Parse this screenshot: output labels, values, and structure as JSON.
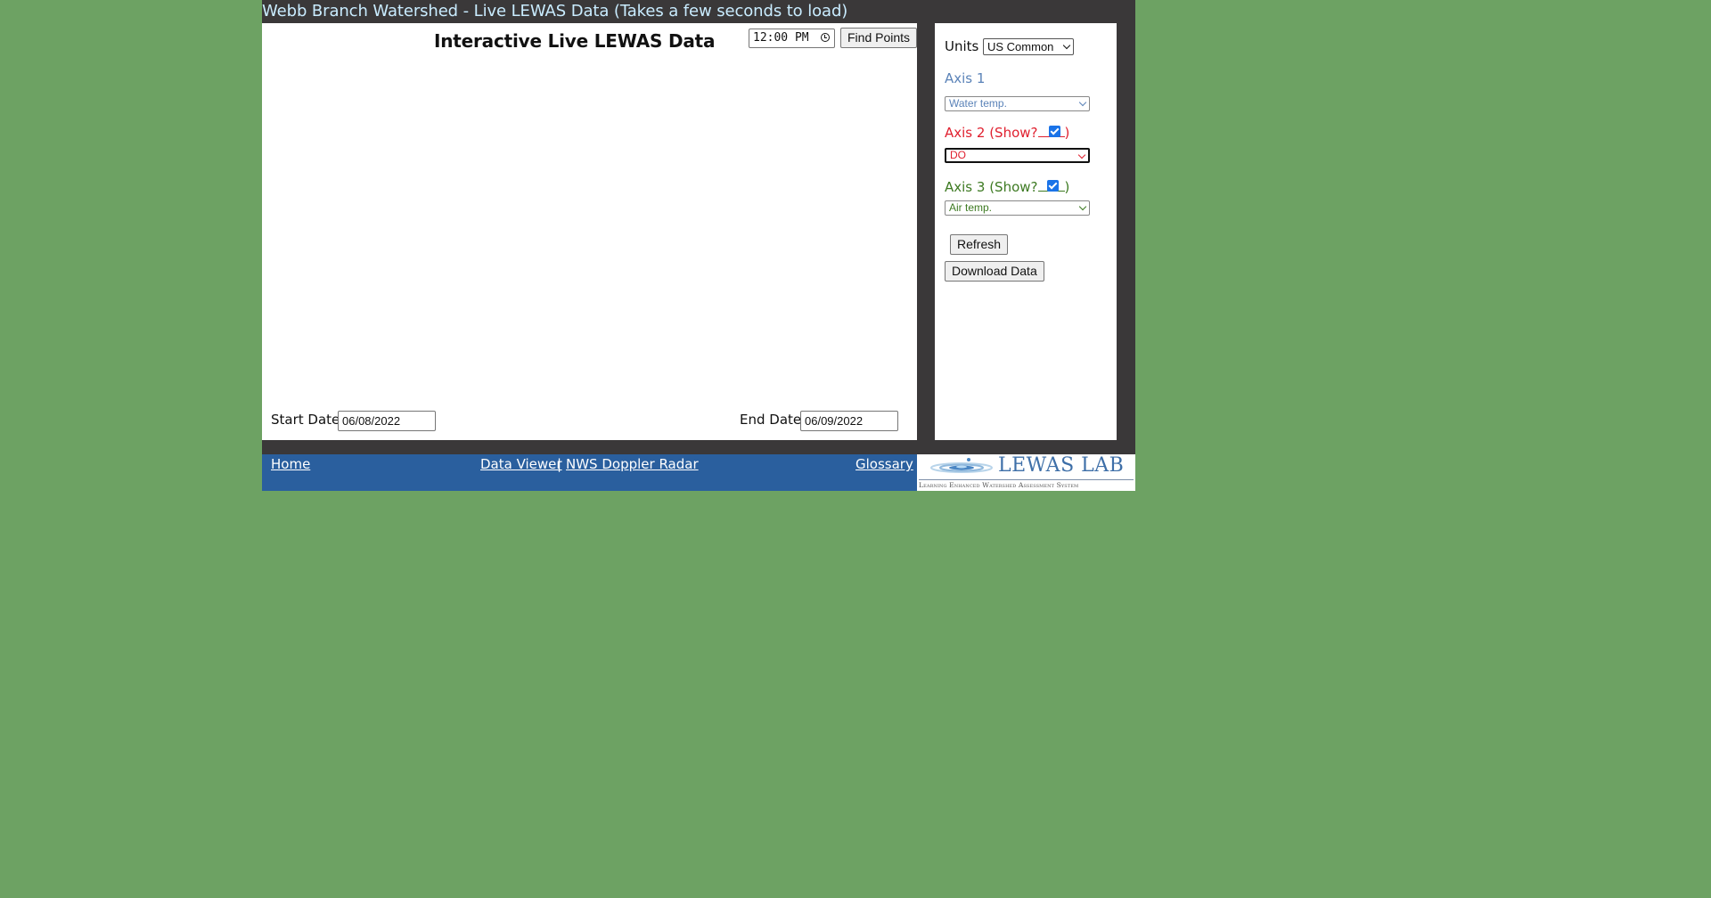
{
  "header": {
    "title": "Webb Branch Watershed - Live LEWAS Data (Takes a few seconds to load)"
  },
  "chart_panel": {
    "title": "Interactive Live LEWAS Data",
    "time_value": "12:00 PM",
    "find_points_label": "Find Points",
    "start_date_label": "Start Date:",
    "start_date_value": "06/08/2022",
    "end_date_label": "End Date:",
    "end_date_value": "06/09/2022"
  },
  "side_panel": {
    "units_label": "Units",
    "units_value": "US Common",
    "axis1": {
      "label": "Axis 1",
      "value": "Water temp.",
      "color": "#5b83b8"
    },
    "axis2": {
      "label": "Axis 2 (Show?",
      "label_end": ")",
      "value": "DO",
      "checked": true,
      "color": "#e0202f"
    },
    "axis3": {
      "label": "Axis 3 (Show?",
      "label_end": ")",
      "value": "Air temp.",
      "checked": true,
      "color": "#3d7a22"
    },
    "refresh_label": "Refresh",
    "download_label": "Download Data"
  },
  "footer": {
    "home": "Home",
    "data_viewer": "Data Viewer",
    "separator": "|",
    "radar": "NWS Doppler Radar",
    "glossary": "Glossary"
  },
  "logo": {
    "title": "LEWAS LAB",
    "subtitle": "Learning Enhanced Watershed Assessment System"
  },
  "colors": {
    "background": "#6da263",
    "frame": "#3a3839",
    "footer": "#2a5f9e",
    "header_text": "#c9ecff"
  }
}
